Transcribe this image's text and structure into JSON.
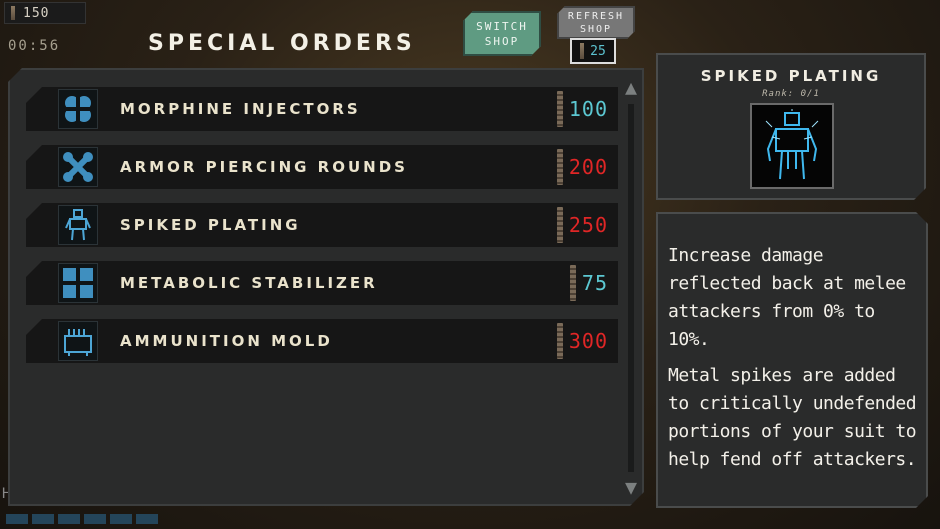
{
  "hud": {
    "scrap": "150",
    "timer": "00:56",
    "edge_letter": "H"
  },
  "title": "SPECIAL ORDERS",
  "buttons": {
    "switch_shop": "SWITCH\nSHOP",
    "refresh_shop": "REFRESH\nSHOP",
    "refresh_cost": "25"
  },
  "items": [
    {
      "name": "MORPHINE INJECTORS",
      "price": "100",
      "affordable": true,
      "icon": "medkit-icon"
    },
    {
      "name": "ARMOR PIERCING ROUNDS",
      "price": "200",
      "affordable": false,
      "icon": "crossed-rounds-icon"
    },
    {
      "name": "SPIKED PLATING",
      "price": "250",
      "affordable": false,
      "icon": "armor-suit-icon"
    },
    {
      "name": "METABOLIC STABILIZER",
      "price": "75",
      "affordable": true,
      "icon": "plus-cross-icon"
    },
    {
      "name": "AMMUNITION MOLD",
      "price": "300",
      "affordable": false,
      "icon": "ammo-mold-icon"
    }
  ],
  "detail": {
    "title": "SPIKED PLATING",
    "rank": "Rank: 0/1",
    "desc_1": "Increase damage reflected back at melee attackers from 0% to 10%.",
    "desc_2": "Metal spikes are added to critically undefended portions of your suit to help fend off attackers."
  },
  "colors": {
    "affordable": "#5cc8d2",
    "unaffordable": "#e02626",
    "switch_button": "#5f9b82"
  }
}
